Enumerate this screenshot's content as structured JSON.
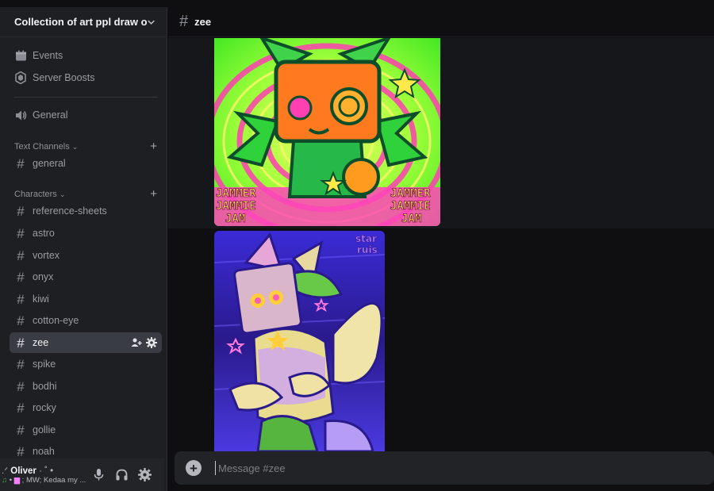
{
  "server": {
    "name": "Collection of art ppl draw o..."
  },
  "nav": {
    "events": "Events",
    "boosts": "Server Boosts",
    "general_voice": "General"
  },
  "categories": {
    "text": "Text Channels",
    "characters": "Characters"
  },
  "channels": {
    "text": [
      "general"
    ],
    "characters": [
      "reference-sheets",
      "astro",
      "vortex",
      "onyx",
      "kiwi",
      "cotton-eye",
      "zee",
      "spike",
      "bodhi",
      "rocky",
      "gollie",
      "noah"
    ]
  },
  "active_channel": "zee",
  "header": {
    "hash": "#",
    "channel_name": "zee"
  },
  "art": {
    "art1_text_left": "JAMMER JAMMIE JAM",
    "art1_text_right": "JAMMER JAMMIE JAM",
    "art2_text": "star ruis",
    "art2_line1": "star",
    "art2_line2": "ruis",
    "art1_l1": "JAMMER",
    "art1_l2": "JAMMIE",
    "art1_l3": "JAM"
  },
  "composer": {
    "placeholder": "Message #zee"
  },
  "user": {
    "name": "Oliver",
    "status": "MW; Kedaa my ..."
  },
  "colors": {
    "sidebar_bg": "#1e1f22",
    "main_bg": "#0f0f12",
    "active_row": "#3a3c43",
    "text_primary": "#f2f3f5",
    "text_muted": "#9a9ca3"
  }
}
